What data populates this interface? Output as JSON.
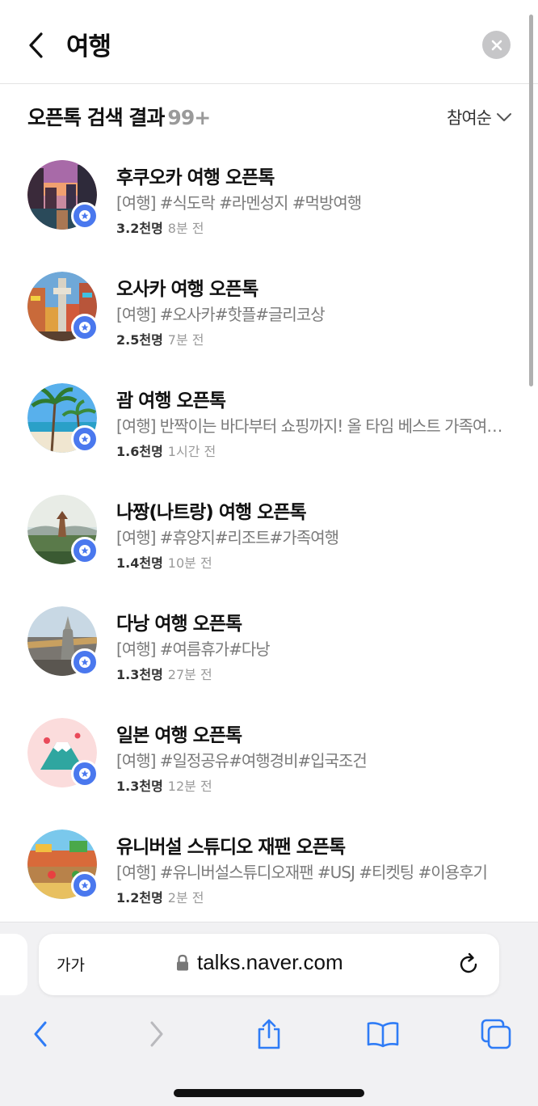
{
  "header": {
    "query": "여행"
  },
  "results": {
    "title": "오픈톡 검색 결과",
    "count": "99+",
    "sort_label": "참여순"
  },
  "items": [
    {
      "title": "후쿠오카 여행 오픈톡",
      "tags": "[여행] #식도락 #라멘성지 #먹방여행",
      "members": "3.2천명",
      "time": "8분 전"
    },
    {
      "title": "오사카 여행 오픈톡",
      "tags": "[여행] #오사카#핫플#글리코상",
      "members": "2.5천명",
      "time": "7분 전"
    },
    {
      "title": "괌 여행 오픈톡",
      "tags": "[여행] 반짝이는 바다부터 쇼핑까지! 올 타임 베스트 가족여행지",
      "members": "1.6천명",
      "time": "1시간 전"
    },
    {
      "title": "나짱(나트랑) 여행 오픈톡",
      "tags": "[여행] #휴양지#리조트#가족여행",
      "members": "1.4천명",
      "time": "10분 전"
    },
    {
      "title": "다낭 여행 오픈톡",
      "tags": "[여행] #여름휴가#다낭",
      "members": "1.3천명",
      "time": "27분 전"
    },
    {
      "title": "일본 여행 오픈톡",
      "tags": "[여행] #일정공유#여행경비#입국조건",
      "members": "1.3천명",
      "time": "12분 전"
    },
    {
      "title": "유니버설 스튜디오 재팬 오픈톡",
      "tags": "[여행] #유니버설스튜디오재팬 #USJ #티켓팅 #이용후기",
      "members": "1.2천명",
      "time": "2분 전"
    }
  ],
  "browser": {
    "reader_label": "가가",
    "url": "talks.naver.com"
  },
  "icons": {
    "back": "chevron-left-icon",
    "clear": "clear-x-icon",
    "sort": "chevron-down-icon",
    "badge": "openchat-badge-icon",
    "lock": "lock-icon",
    "reload": "reload-icon",
    "share": "share-icon",
    "bookmarks": "bookmarks-icon",
    "tabs": "tabs-icon"
  },
  "colors": {
    "accent": "#4a78ee",
    "safari_blue": "#2f7cf6"
  }
}
